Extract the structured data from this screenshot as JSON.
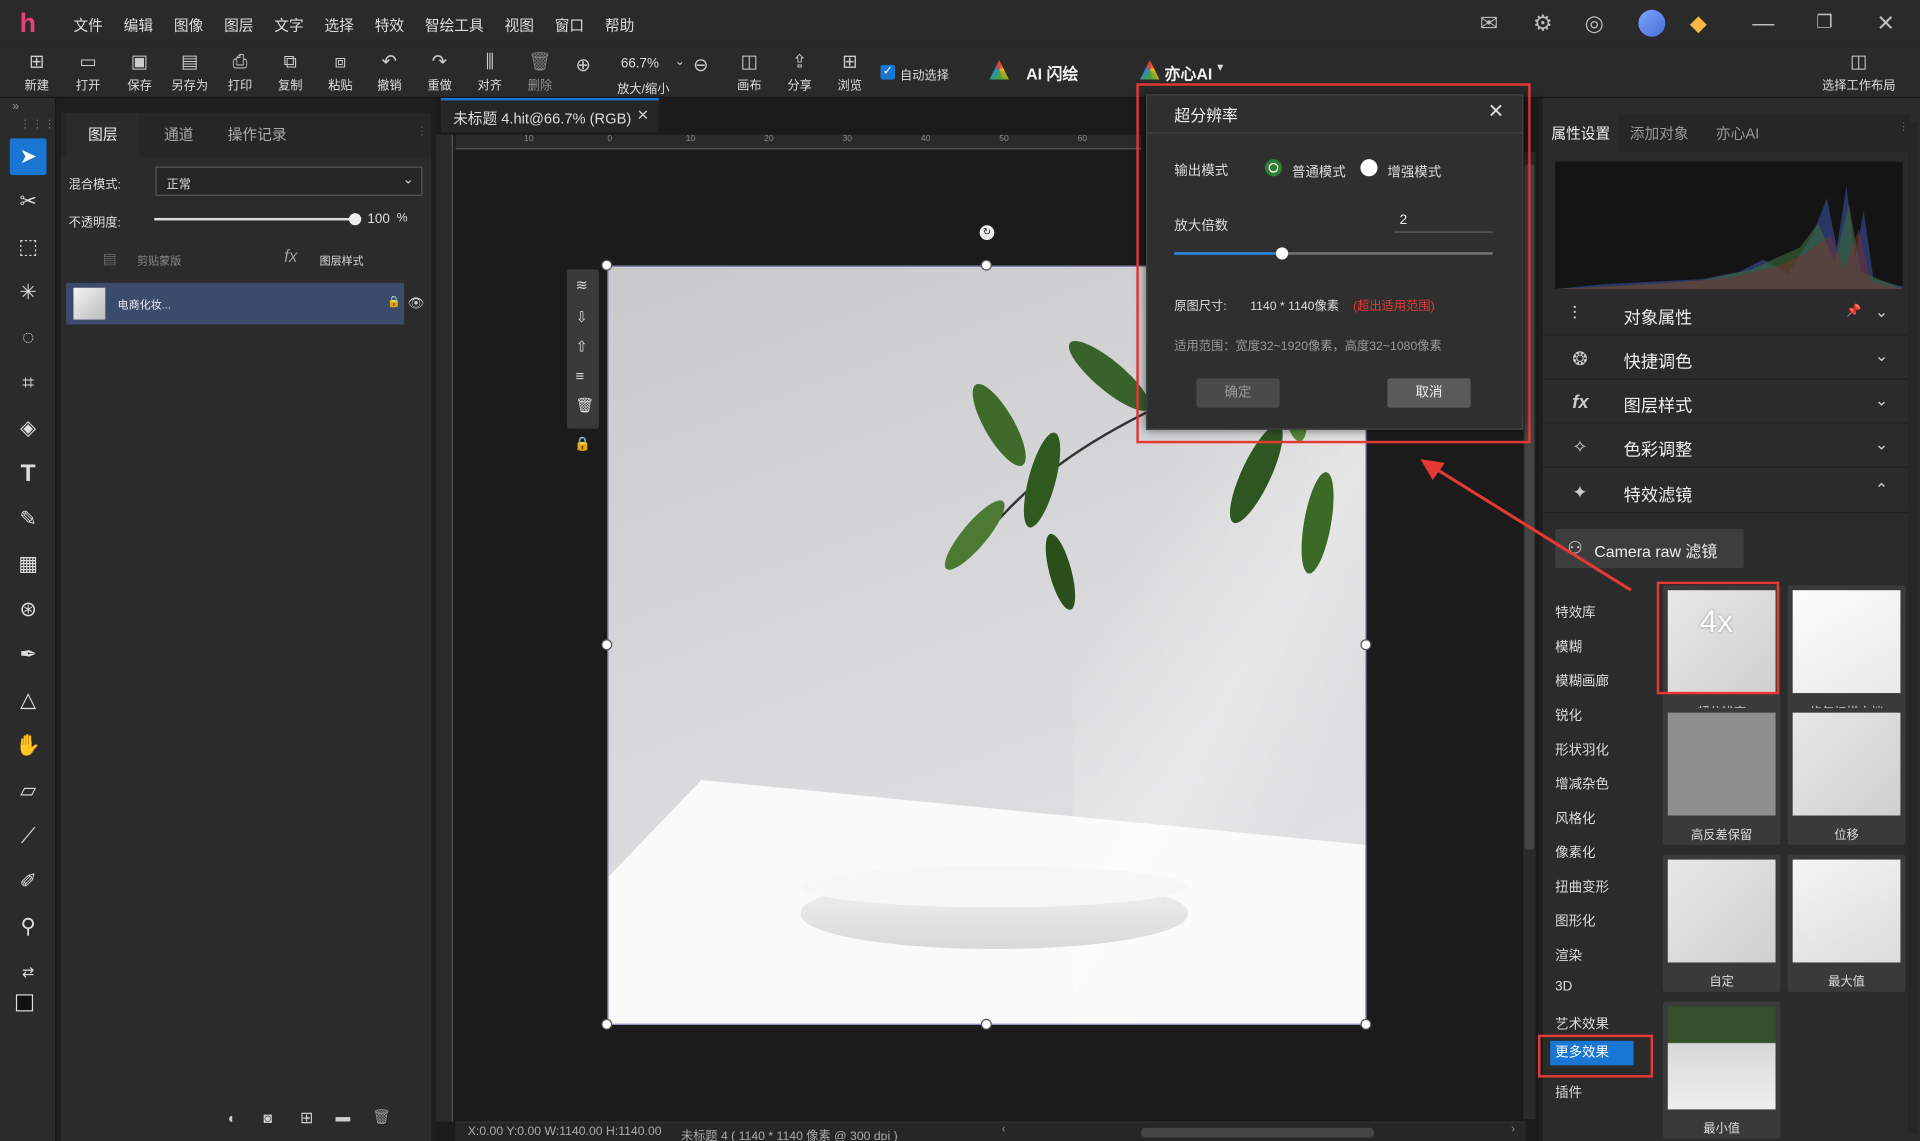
{
  "menu": [
    "文件",
    "编辑",
    "图像",
    "图层",
    "文字",
    "选择",
    "特效",
    "智绘工具",
    "视图",
    "窗口",
    "帮助"
  ],
  "toolbar": {
    "buttons": [
      "新建",
      "打开",
      "保存",
      "另存为",
      "打印",
      "复制",
      "粘贴",
      "撤销",
      "重做",
      "对齐",
      "删除"
    ],
    "zoom_value": "66.7%",
    "zoom_label": "放大/缩小",
    "buttons2": [
      "画布",
      "分享",
      "浏览"
    ],
    "auto_select": "自动选择",
    "ai_flash": "AI 闪绘",
    "yixin_ai": "亦心AI",
    "workspace": "选择工作布局"
  },
  "layers": {
    "tabs": [
      "图层",
      "通道",
      "操作记录"
    ],
    "blend_label": "混合模式:",
    "blend_value": "正常",
    "opacity_label": "不透明度:",
    "opacity_value": "100",
    "opacity_pct": 1.0,
    "opacity_unit": "%",
    "clip_mask": "剪贴蒙版",
    "layer_style": "图层样式",
    "layer_name": "电商化妆..."
  },
  "document": {
    "tab_title": "未标题 4.hit@66.7% (RGB)",
    "ruler_labels": [
      "10",
      "0",
      "10",
      "20",
      "30",
      "40",
      "50",
      "60"
    ],
    "status_coords": "X:0.00 Y:0.00 W:1140.00 H:1140.00",
    "status_doc": "未标题 4 ( 1140 * 1140 像素 @ 300 dpi )"
  },
  "dialog": {
    "title": "超分辨率",
    "output_mode_label": "输出模式",
    "mode_normal": "普通模式",
    "mode_enhanced": "增强模式",
    "scale_label": "放大倍数",
    "scale_value": "2",
    "scale_pct": 0.34,
    "orig_size_label": "原图尺寸:",
    "orig_size_value": "1140 * 1140像素",
    "out_of_range": "(超出适用范围)",
    "range_text": "适用范围：宽度32~1920像素，高度32~1080像素",
    "ok": "确定",
    "cancel": "取消"
  },
  "right": {
    "tabs": [
      "属性设置",
      "添加对象",
      "亦心AI"
    ],
    "sections": [
      "对象属性",
      "快捷调色",
      "图层样式",
      "色彩调整",
      "特效滤镜"
    ],
    "camera_raw": "Camera raw 滤镜",
    "categories": [
      "特效库",
      "模糊",
      "模糊画廊",
      "锐化",
      "形状羽化",
      "增减杂色",
      "风格化",
      "像素化",
      "扭曲变形",
      "图形化",
      "渲染",
      "3D",
      "艺术效果",
      "更多效果",
      "插件"
    ],
    "thumbs": [
      "超分辨率",
      "修复扫描文档",
      "高反差保留",
      "位移",
      "自定",
      "最大值",
      "最小值"
    ],
    "thumb_4x": "4x"
  },
  "colors": {
    "accent": "#1976d2",
    "highlight": "#e53935",
    "panel": "#2b2b2b"
  }
}
